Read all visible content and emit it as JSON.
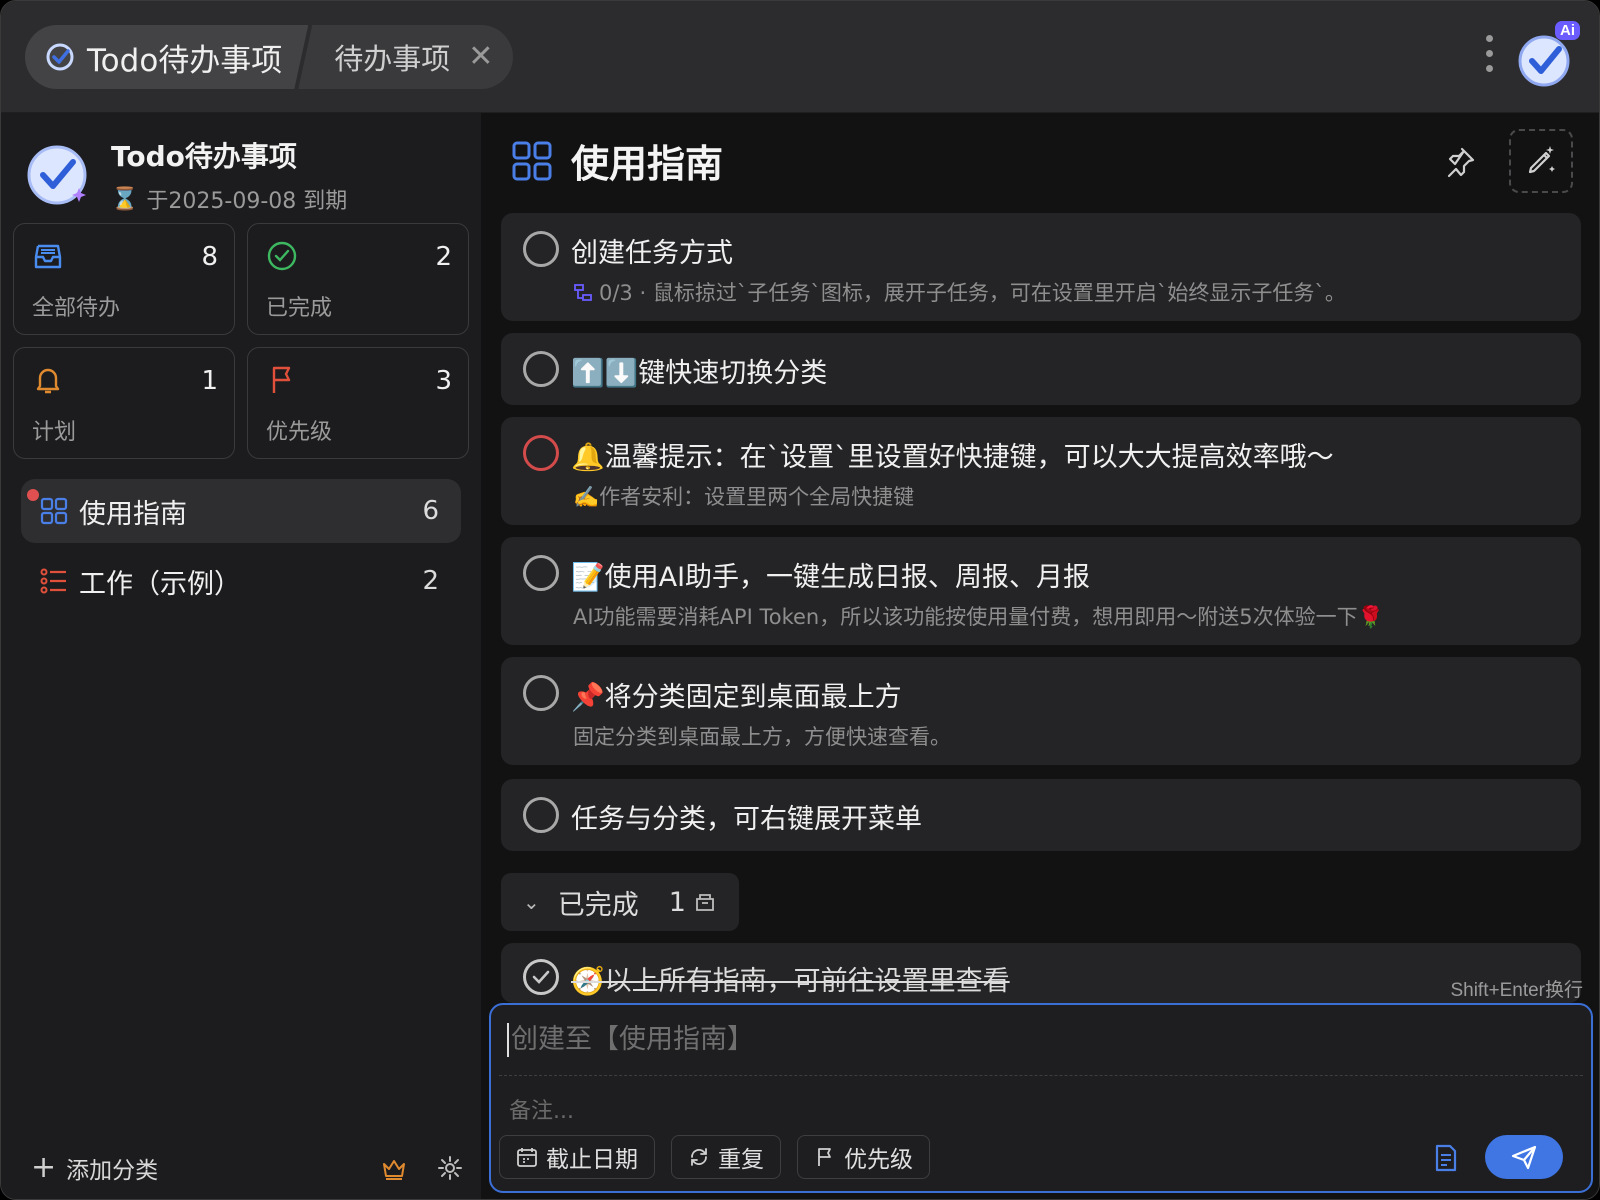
{
  "titlebar": {
    "app_tab": "Todo待办事项",
    "sub_tab": "待办事项",
    "close_glyph": "✕",
    "ai_badge": "Ai"
  },
  "sidebar": {
    "profile_name": "Todo待办事项",
    "expiry": "于2025-09-08 到期",
    "stats": [
      {
        "label": "全部待办",
        "count": "8",
        "icon": "inbox-icon",
        "color": "#4a8df0"
      },
      {
        "label": "已完成",
        "count": "2",
        "icon": "check-circle-icon",
        "color": "#3db860"
      },
      {
        "label": "计划",
        "count": "1",
        "icon": "bell-icon",
        "color": "#e08a30"
      },
      {
        "label": "优先级",
        "count": "3",
        "icon": "flag-icon",
        "color": "#e0503a"
      }
    ],
    "categories": [
      {
        "label": "使用指南",
        "count": "6",
        "icon": "grid-icon"
      },
      {
        "label": "工作（示例）",
        "count": "2",
        "icon": "list-icon"
      }
    ],
    "add_category": "添加分类"
  },
  "main": {
    "title": "使用指南",
    "tasks": [
      {
        "title": "创建任务方式",
        "note": "0/3 · 鼠标掠过`子任务`图标，展开子任务，可在设置里开启`始终显示子任务`。"
      },
      {
        "title": "⬆️⬇️键快速切换分类",
        "note": ""
      },
      {
        "title": "🔔温馨提示：在`设置`里设置好快捷键，可以大大提高效率哦～",
        "note": "✍️作者安利：设置里两个全局快捷键"
      },
      {
        "title": "📝使用AI助手，一键生成日报、周报、月报",
        "note": "AI功能需要消耗API Token，所以该功能按使用量付费，想用即用～附送5次体验一下🌹"
      },
      {
        "title": "📌将分类固定到桌面最上方",
        "note": "固定分类到桌面最上方，方便快速查看。"
      },
      {
        "title": "任务与分类，可右键展开菜单",
        "note": ""
      }
    ],
    "done_group": {
      "label": "已完成",
      "count": "1"
    },
    "done_tasks": [
      {
        "title": "🧭以上所有指南，可前往设置里查看"
      }
    ],
    "hint": "Shift+Enter换行"
  },
  "composer": {
    "placeholder": "创建至【使用指南】",
    "note_placeholder": "备注...",
    "due_date": "截止日期",
    "repeat": "重复",
    "priority": "优先级"
  },
  "colors": {
    "accent": "#3f76e4",
    "alert": "#d34b4b"
  }
}
